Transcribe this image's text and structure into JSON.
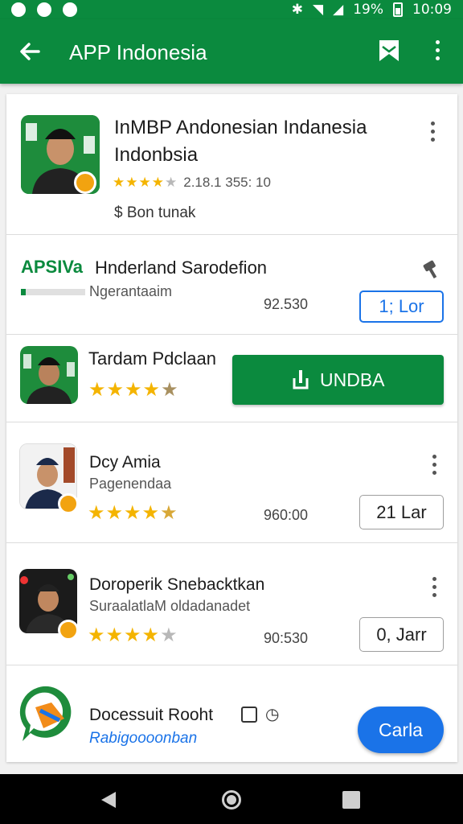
{
  "status_bar": {
    "battery": "19%",
    "time": "10:09"
  },
  "app_bar": {
    "title": "APP Indonesia"
  },
  "featured": {
    "title_line1": "InMBP Andonesian Indanesia",
    "title_line2": "Indonbsia",
    "rating_text": "2.18.1 355: 10",
    "price": "$ Bon tunak"
  },
  "update_row": {
    "brand": "APSIVa",
    "name": "Hnderland Sarodefion",
    "subtitle": "Ngerantaaim",
    "size": "92.530",
    "button": "1; Lor"
  },
  "install_row": {
    "name": "Tardam Pdclaan",
    "button": "UNDBA",
    "rating": 4
  },
  "list": [
    {
      "name": "Dcy Amia",
      "subtitle": "Pagenendaa",
      "size": "960:00",
      "button": "21 Lar",
      "rating": 4.5
    },
    {
      "name": "Doroperik Snebacktkan",
      "subtitle": "SuraalatlaM oldadanadet",
      "size": "90:530",
      "button": "0, Jarr",
      "rating": 4
    }
  ],
  "promo": {
    "name": "Docessuit Rooht",
    "subtitle": "Rabigoooonban",
    "button": "Carla"
  },
  "colors": {
    "primary_green": "#0b8a3e",
    "accent_blue": "#1a73e8",
    "star": "#f4b400"
  }
}
